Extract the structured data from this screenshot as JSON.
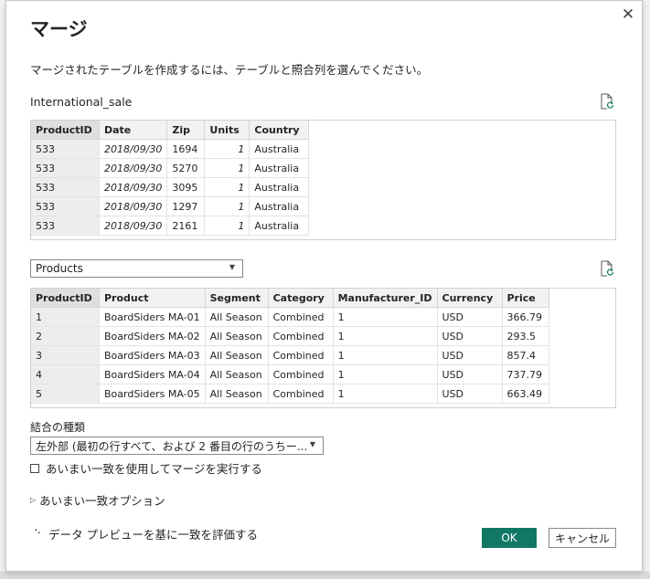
{
  "dialog": {
    "title": "マージ",
    "subtitle": "マージされたテーブルを作成するには、テーブルと照合列を選んでください。",
    "close_glyph": "✕"
  },
  "table1": {
    "name": "International_sale",
    "columns": [
      "ProductID",
      "Date",
      "Zip",
      "Units",
      "Country"
    ],
    "rows": [
      [
        "533",
        "2018/09/30",
        "1694",
        "1",
        "Australia"
      ],
      [
        "533",
        "2018/09/30",
        "5270",
        "1",
        "Australia"
      ],
      [
        "533",
        "2018/09/30",
        "3095",
        "1",
        "Australia"
      ],
      [
        "533",
        "2018/09/30",
        "1297",
        "1",
        "Australia"
      ],
      [
        "533",
        "2018/09/30",
        "2161",
        "1",
        "Australia"
      ]
    ]
  },
  "table2": {
    "selected": "Products",
    "columns": [
      "ProductID",
      "Product",
      "Segment",
      "Category",
      "Manufacturer_ID",
      "Currency",
      "Price"
    ],
    "rows": [
      [
        "1",
        "BoardSiders MA-01",
        "All Season",
        "Combined",
        "1",
        "USD",
        "366.79"
      ],
      [
        "2",
        "BoardSiders MA-02",
        "All Season",
        "Combined",
        "1",
        "USD",
        "293.5"
      ],
      [
        "3",
        "BoardSiders MA-03",
        "All Season",
        "Combined",
        "1",
        "USD",
        "857.4"
      ],
      [
        "4",
        "BoardSiders MA-04",
        "All Season",
        "Combined",
        "1",
        "USD",
        "737.79"
      ],
      [
        "5",
        "BoardSiders MA-05",
        "All Season",
        "Combined",
        "1",
        "USD",
        "663.49"
      ]
    ]
  },
  "join": {
    "label": "結合の種類",
    "selected": "左外部 (最初の行すべて、および 2 番目の行のうちー..."
  },
  "fuzzy": {
    "checkbox_label": "あいまい一致を使用してマージを実行する",
    "checked": false,
    "options_label": "あいまい一致オプション"
  },
  "status": {
    "text": "データ プレビューを基に一致を評価する"
  },
  "buttons": {
    "ok": "OK",
    "cancel": "キャンセル"
  },
  "colors": {
    "accent": "#117865"
  },
  "icons": {
    "refresh": "refresh-document-icon",
    "dropdown": "chevron-down-icon",
    "expander": "triangle-right-icon",
    "spinner": "loading-dots-icon"
  }
}
